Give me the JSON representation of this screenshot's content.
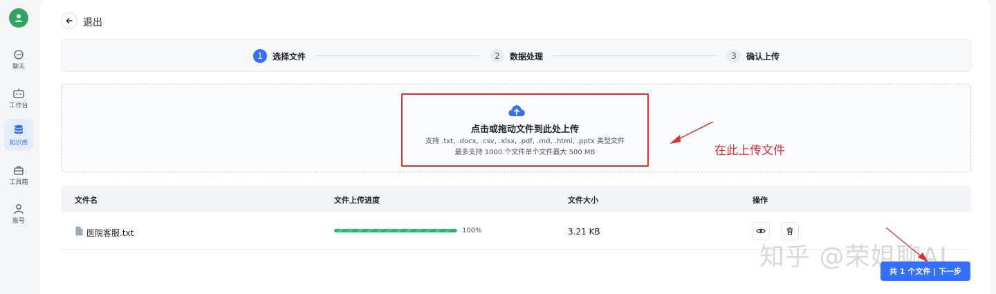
{
  "sidebar": {
    "items": [
      {
        "label": "聊天",
        "icon": "chat-icon"
      },
      {
        "label": "工作台",
        "icon": "robot-icon"
      },
      {
        "label": "知识库",
        "icon": "database-icon"
      },
      {
        "label": "工具箱",
        "icon": "toolbox-icon"
      },
      {
        "label": "账号",
        "icon": "user-icon"
      }
    ]
  },
  "header": {
    "back_label": "退出"
  },
  "steps": [
    {
      "num": "1",
      "label": "选择文件"
    },
    {
      "num": "2",
      "label": "数据处理"
    },
    {
      "num": "3",
      "label": "确认上传"
    }
  ],
  "upload": {
    "title": "点击或拖动文件到此处上传",
    "formats": "支持 .txt, .docx, .csv, .xlsx, .pdf, .md, .html, .pptx 类型文件",
    "limits": "最多支持 1000 个文件单个文件最大 500 MB"
  },
  "annotation": "在此上传文件",
  "table": {
    "headers": [
      "文件名",
      "文件上传进度",
      "文件大小",
      "操作"
    ],
    "rows": [
      {
        "name": "医院客服.txt",
        "progress": "100%",
        "progress_value": 1.0,
        "size": "3.21 KB"
      }
    ]
  },
  "next_button": "共 1 个文件 | 下一步",
  "watermark": "知乎 @荣姐聊AI",
  "colors": {
    "accent": "#3370ff",
    "annotation": "#e03030",
    "progress": "#27b36a",
    "avatar": "#2fa55f"
  }
}
